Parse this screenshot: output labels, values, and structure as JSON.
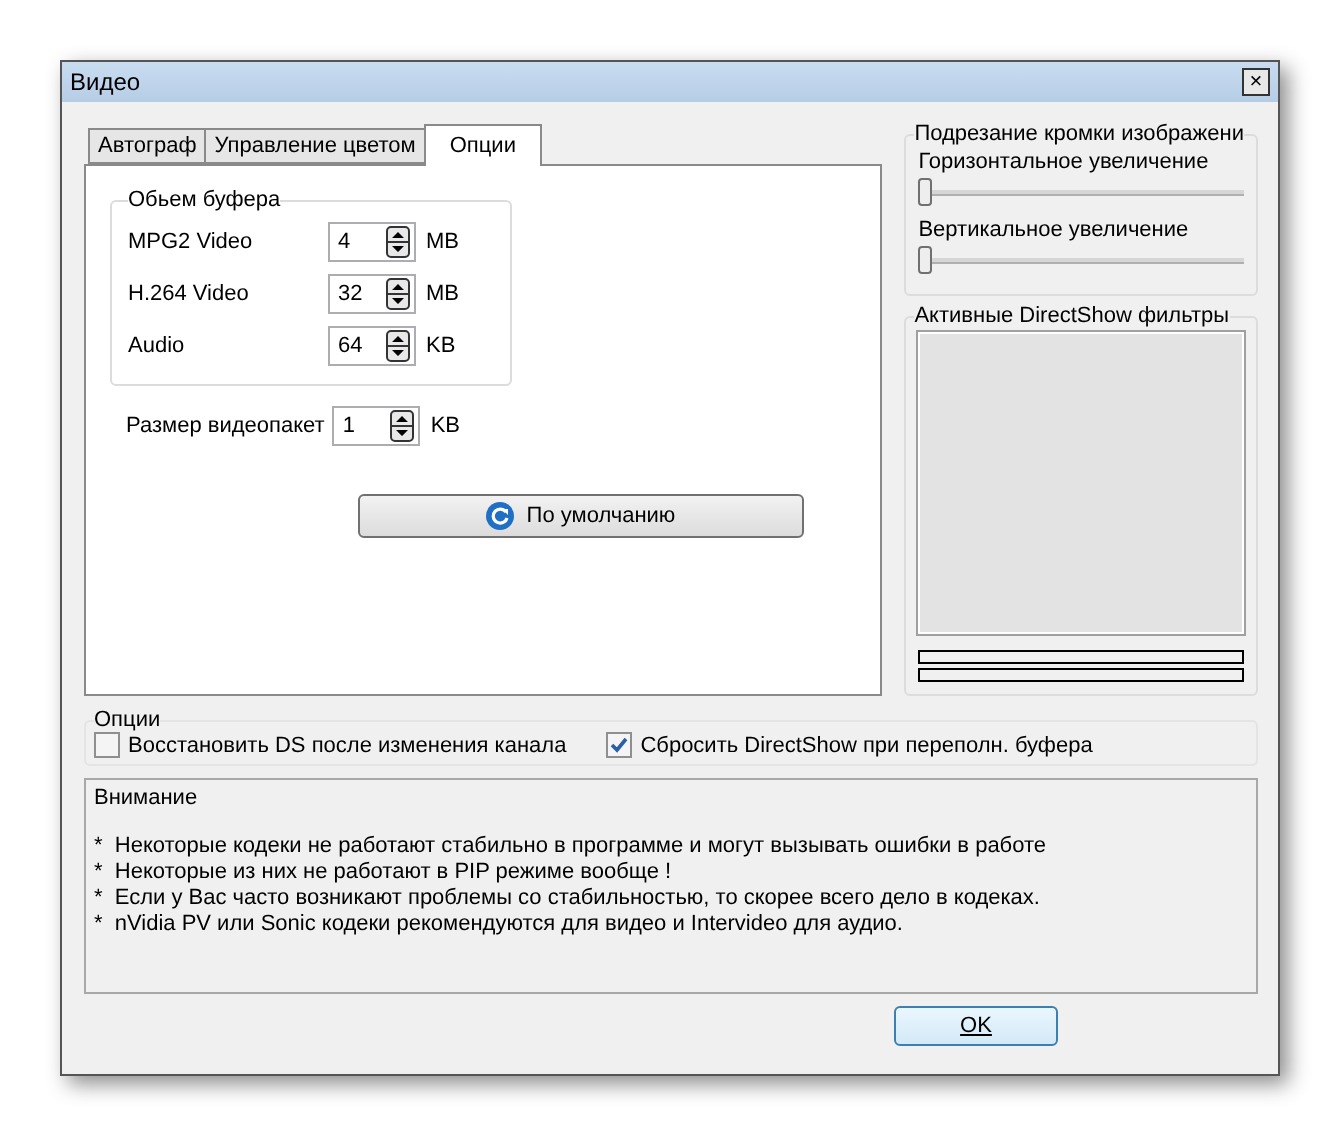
{
  "window": {
    "title": "Видео",
    "close": "×"
  },
  "tabs": [
    {
      "label": "Автограф",
      "selected": false
    },
    {
      "label": "Управление цветом",
      "selected": false
    },
    {
      "label": "Опции",
      "selected": true
    }
  ],
  "buffer": {
    "title": "Обьем буфера",
    "rows": [
      {
        "label": "MPG2 Video",
        "value": "4",
        "unit": "MB"
      },
      {
        "label": "H.264 Video",
        "value": "32",
        "unit": "MB"
      },
      {
        "label": "Audio",
        "value": "64",
        "unit": "KB"
      }
    ]
  },
  "packet": {
    "label": "Размер видеопакет",
    "value": "1",
    "unit": "KB"
  },
  "default_button": "По умолчанию",
  "crop": {
    "title": "Подрезание кромки изображени",
    "sliders": [
      {
        "label": "Горизонтальное увеличение",
        "level": 0
      },
      {
        "label": "Вертикальное увеличение",
        "level": 0
      }
    ]
  },
  "filters": {
    "title": "Активные DirectShow фильтры"
  },
  "options": {
    "title": "Опции",
    "checkboxes": [
      {
        "label": "Восстановить DS после изменения канала",
        "checked": false
      },
      {
        "label": "Сбросить DirectShow при переполн. буфера",
        "checked": true
      }
    ]
  },
  "notice": {
    "title": "Внимание",
    "lines": [
      "*  Некоторые кодеки не работают стабильно в программе и могут вызывать ошибки в работе",
      "*  Некоторые из них не работают в PIP режиме вообще !",
      "*  Если у Вас часто возникают проблемы со стабильностью, то скорее всего дело в кодеках.",
      "*  nVidia PV или Sonic кодеки рекомендуются для видео и Intervideo для аудио."
    ]
  },
  "ok_button": "OK"
}
